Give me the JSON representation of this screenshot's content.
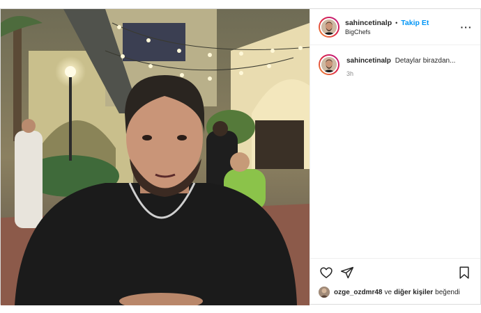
{
  "post": {
    "username": "sahincetinalp",
    "separator": "•",
    "follow_label": "Takip Et",
    "location": "BigChefs",
    "more_label": "···",
    "caption_user": "sahincetinalp",
    "caption_text": "Detaylar birazdan...",
    "caption_time": "3h"
  },
  "likes": {
    "liker": "ozge_ozdmr48",
    "joiner": "ve",
    "others": "diğer kişiler",
    "suffix": "beğendi"
  },
  "icons": {
    "like": "heart-icon",
    "share": "paper-plane-icon",
    "save": "bookmark-icon",
    "more": "more-options-icon"
  },
  "colors": {
    "accent": "#0095f6",
    "text": "#262626",
    "muted": "#8e8e8e"
  }
}
